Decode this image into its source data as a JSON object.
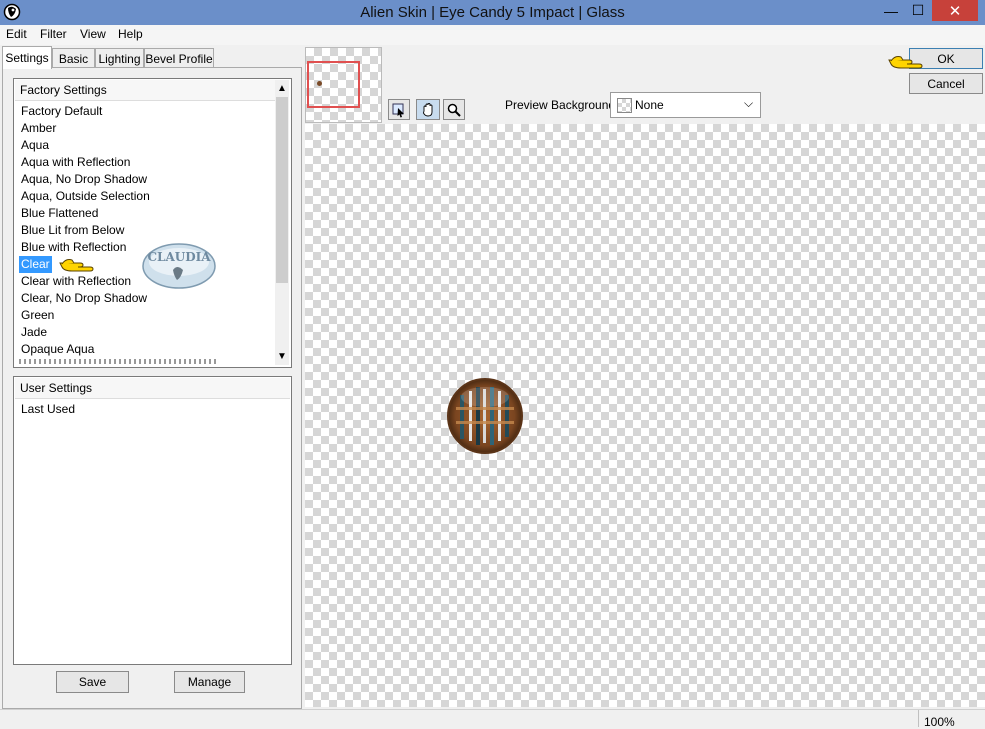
{
  "window": {
    "title": "Alien Skin | Eye Candy 5 Impact | Glass",
    "minimize_glyph": "—",
    "maximize_glyph": "☐",
    "close_glyph": "✕"
  },
  "menu": [
    "Edit",
    "Filter",
    "View",
    "Help"
  ],
  "tabs": [
    "Settings",
    "Basic",
    "Lighting",
    "Bevel Profile"
  ],
  "factory_settings": {
    "header": "Factory Settings",
    "items": [
      "Factory Default",
      "Amber",
      "Aqua",
      "Aqua with Reflection",
      "Aqua, No Drop Shadow",
      "Aqua, Outside Selection",
      "Blue Flattened",
      "Blue Lit from Below",
      "Blue with Reflection",
      "Clear",
      "Clear with Reflection",
      "Clear, No Drop Shadow",
      "Green",
      "Jade",
      "Opaque Aqua"
    ],
    "selected": "Clear"
  },
  "user_settings": {
    "header": "User Settings",
    "items": [
      "Last Used"
    ]
  },
  "buttons": {
    "save": "Save",
    "manage": "Manage",
    "ok": "OK",
    "cancel": "Cancel"
  },
  "preview_background": {
    "label": "Preview Background:",
    "value": "None"
  },
  "watermark": {
    "text": "CLAUDIA"
  },
  "status": {
    "zoom": "100%"
  },
  "colors": {
    "titlebar": "#6b8fc9",
    "close_button": "#c7413a",
    "selection": "#3399ff",
    "navigator_frame": "#e05050"
  }
}
